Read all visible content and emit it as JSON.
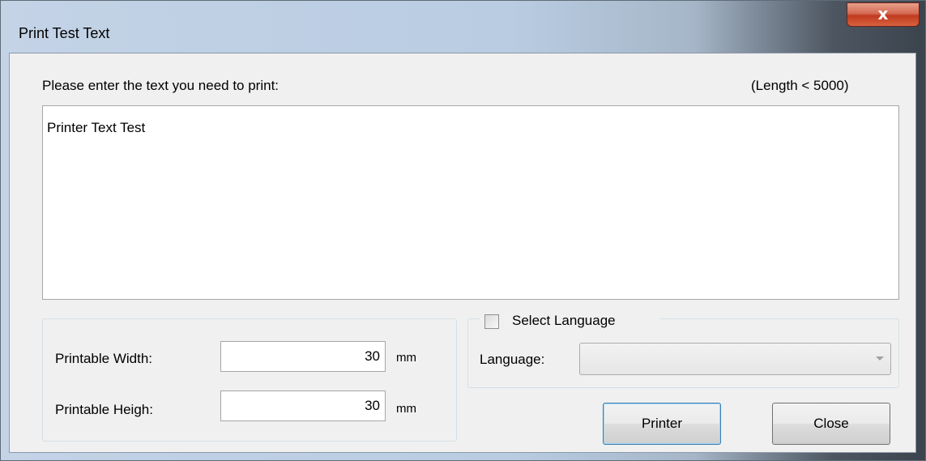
{
  "window": {
    "title": "Print Test Text",
    "close_glyph": "x"
  },
  "prompt": {
    "label": "Please enter the text you need to print:",
    "length_hint": "(Length < 5000)"
  },
  "text_area": {
    "value": "Printer Text Test"
  },
  "size_group": {
    "width_label": "Printable Width:",
    "width_value": "30",
    "width_unit": "mm",
    "height_label": "Printable Heigh:",
    "height_value": "30",
    "height_unit": "mm"
  },
  "language_group": {
    "checkbox_label": "Select Language",
    "checked": false,
    "language_label": "Language:",
    "language_value": ""
  },
  "buttons": {
    "printer_label": "Printer",
    "close_label": "Close"
  },
  "colors": {
    "close_button": "#c03a1f",
    "default_button_border": "#3c7fb1",
    "dialog_background": "#f0f0f0"
  },
  "icons": {
    "close": "close-icon",
    "dropdown": "chevron-down-icon"
  }
}
